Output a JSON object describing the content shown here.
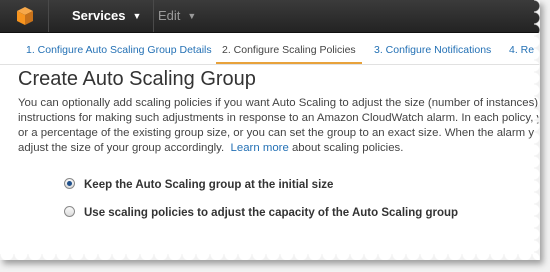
{
  "topbar": {
    "logo_icon": "aws-cube-icon",
    "brand_color": "#f7941e",
    "services_label": "Services",
    "edit_label": "Edit"
  },
  "steps": [
    {
      "label": "1. Configure Auto Scaling Group Details",
      "active": false
    },
    {
      "label": "2. Configure Scaling Policies",
      "active": true
    },
    {
      "label": "3. Configure Notifications",
      "active": false
    },
    {
      "label": "4. Re",
      "active": false
    }
  ],
  "page": {
    "title": "Create Auto Scaling Group",
    "desc_line1": "You can optionally add scaling policies if you want Auto Scaling to adjust the size (number of instances)",
    "desc_line2": "instructions for making such adjustments in response to an Amazon CloudWatch alarm. In each policy, y",
    "desc_line3": "or a percentage of the existing group size, or you can set the group to an exact size. When the alarm y",
    "desc_line4_prefix": "adjust the size of your group accordingly.",
    "learn_more": "Learn more",
    "desc_line4_suffix": "about scaling policies."
  },
  "options": [
    {
      "label": "Keep the Auto Scaling group at the initial size",
      "selected": true
    },
    {
      "label": "Use scaling policies to adjust the capacity of the Auto Scaling group",
      "selected": false
    }
  ]
}
